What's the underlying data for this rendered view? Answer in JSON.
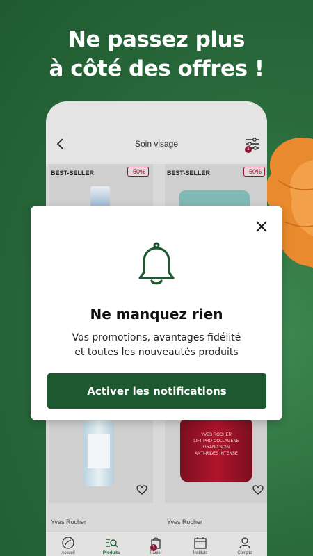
{
  "headline": {
    "line1": "Ne passez plus",
    "line2": "à côté des offres !"
  },
  "screen": {
    "title": "Soin visage",
    "filter_badge": "1",
    "products": [
      {
        "tag": "BEST-SELLER",
        "discount": "-50%",
        "brand": "Yves Rocher"
      },
      {
        "tag": "BEST-SELLER",
        "discount": "-50%",
        "brand": "Yves Rocher",
        "jar_brand": "YVES ROCHER",
        "jar_line1": "LIFT PRO-COLLAGÈNE",
        "jar_line2": "GRAND SOIN",
        "jar_line3": "ANTI-RIDES INTENSE"
      }
    ],
    "tabs": [
      {
        "label": "Accueil",
        "icon": "home-icon"
      },
      {
        "label": "Produits",
        "icon": "search-list-icon"
      },
      {
        "label": "Panier",
        "icon": "bag-icon",
        "badge": "1"
      },
      {
        "label": "Instituts",
        "icon": "calendar-icon"
      },
      {
        "label": "Compte",
        "icon": "user-icon"
      }
    ]
  },
  "modal": {
    "title": "Ne manquez rien",
    "text_line1": "Vos promotions, avantages fidélité",
    "text_line2": "et toutes les nouveautés produits",
    "button": "Activer les notifications"
  },
  "colors": {
    "brand_green": "#1d5830",
    "accent_burgundy": "#8a1535",
    "flower_orange": "#e98a2e"
  }
}
